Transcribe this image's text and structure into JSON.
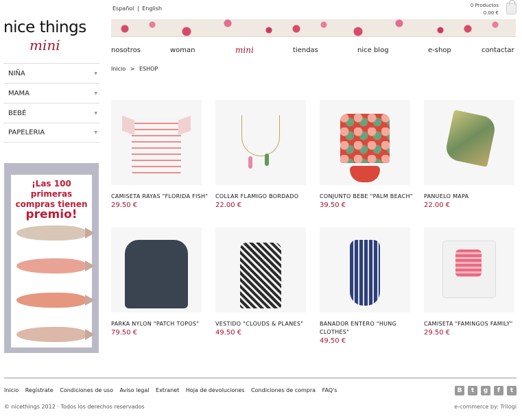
{
  "logo": {
    "main": "nice things",
    "sub": "mini"
  },
  "lang": [
    "Español",
    "|",
    "English"
  ],
  "cart": {
    "count": "0 Productos",
    "total": "0.00 €"
  },
  "nav": [
    "nosotros",
    "woman",
    "mini",
    "tiendas",
    "nice blog",
    "e-shop",
    "contactar"
  ],
  "breadcrumb": {
    "home": "Inicio",
    "sep": ">",
    "current": "ESHOP"
  },
  "sidebar": [
    "NIÑA",
    "MAMA",
    "BEBÉ",
    "PAPELERIA"
  ],
  "promo": {
    "line1": "¡Las 100 primeras",
    "line2": "compras tienen",
    "line3": "premio!"
  },
  "products": [
    {
      "name": "CAMISETA RAYAS \"FLORIDA FISH\"",
      "price": "29.50 €"
    },
    {
      "name": "COLLAR FLAMIGO BORDADO",
      "price": "22.00 €"
    },
    {
      "name": "CONJUNTO BEBE \"PALM BEACH\"",
      "price": "39.50 €"
    },
    {
      "name": "PANUELO MAPA",
      "price": "22.00 €"
    },
    {
      "name": "PARKA NYLON \"PATCH TOPOS\"",
      "price": "79.50 €"
    },
    {
      "name": "VESTIDO \"CLOUDS & PLANES\"",
      "price": "49.50 €"
    },
    {
      "name": "BANADOR ENTERO \"HUNG CLOTHES\"",
      "price": "49.50 €"
    },
    {
      "name": "CAMISETA \"FAMINGOS FAMILY\"",
      "price": "29.50 €"
    }
  ],
  "footer": {
    "links": [
      "Inicio",
      "Regístrate",
      "Condiciones de uso",
      "Aviso legal",
      "Extranet",
      "Hoja de devoluciones",
      "Condiciones de compra",
      "FAQ's"
    ],
    "copyright": "© nicethings 2012 · Todos los derechos reservados",
    "credit": "e-commerce by: Trilogi",
    "social": [
      "blogger-icon",
      "tumblr-icon",
      "google-plus-icon",
      "facebook-icon",
      "twitter-icon"
    ]
  }
}
